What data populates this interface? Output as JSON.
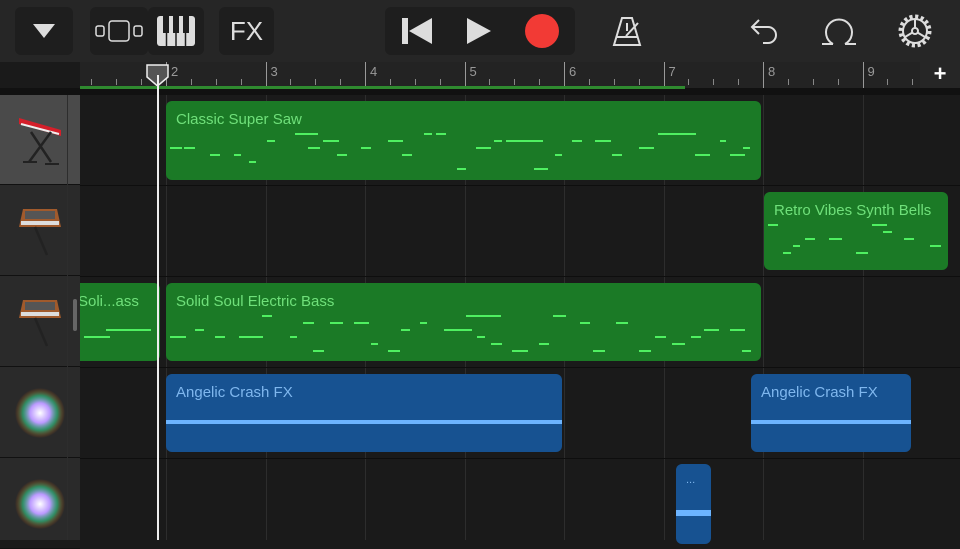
{
  "toolbar": {
    "fx_label": "FX",
    "record_color": "#f23a35"
  },
  "ruler": {
    "bars": [
      "2",
      "3",
      "4",
      "5",
      "6",
      "7",
      "8",
      "9"
    ],
    "add_label": "+"
  },
  "tracks": [
    {
      "instrument": "red-keyboard-icon",
      "regions": [
        {
          "name": "Classic Super Saw",
          "type": "midi"
        }
      ]
    },
    {
      "instrument": "retro-synth-icon",
      "regions": [
        {
          "name": "Retro Vibes Synth Bells",
          "type": "midi"
        }
      ]
    },
    {
      "instrument": "retro-synth-icon",
      "regions": [
        {
          "name": "Soli...ass",
          "type": "midi"
        },
        {
          "name": "Solid Soul Electric Bass",
          "type": "midi"
        }
      ]
    },
    {
      "instrument": "sparkle-fx-icon",
      "regions": [
        {
          "name": "Angelic Crash FX",
          "type": "audio"
        },
        {
          "name": "Angelic Crash FX",
          "type": "audio"
        }
      ]
    },
    {
      "instrument": "sparkle-fx-icon",
      "regions": [
        {
          "name": "...",
          "type": "audio"
        }
      ]
    }
  ]
}
